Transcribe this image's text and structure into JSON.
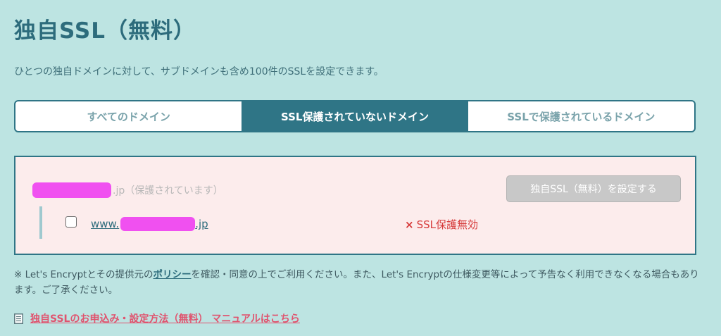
{
  "page": {
    "title": "独自SSL（無料）",
    "description": "ひとつの独自ドメインに対して、サブドメインも含め100件のSSLを設定できます。"
  },
  "tabs": [
    {
      "label": "すべてのドメイン",
      "active": false
    },
    {
      "label": "SSL保護されていないドメイン",
      "active": true
    },
    {
      "label": "SSLで保護されているドメイン",
      "active": false
    }
  ],
  "domain_entry": {
    "suffix": ".jp（保護されています）",
    "setup_button": "独自SSL（無料）を設定する",
    "subdomain": {
      "prefix": "www.",
      "suffix": ".jp",
      "checked": false,
      "status_mark": "×",
      "status_text": "SSL保護無効"
    }
  },
  "notice": {
    "before_link": "※ Let's Encryptとその提供元の",
    "link_text": "ポリシー",
    "after_link": "を確認・同意の上でご利用ください。また、Let's Encryptの仕様変更等によって予告なく利用できなくなる場合もあります。ご了承ください。"
  },
  "manual": {
    "icon": "document-icon",
    "link_text": "独自SSLのお申込み・設定方法（無料） マニュアルはこちら"
  },
  "colors": {
    "background": "#bde4e2",
    "accent": "#2f7586",
    "panel_bg": "#fcecec",
    "error": "#d63a3a",
    "link_pink": "#e0536e",
    "redaction": "#f050f0"
  }
}
